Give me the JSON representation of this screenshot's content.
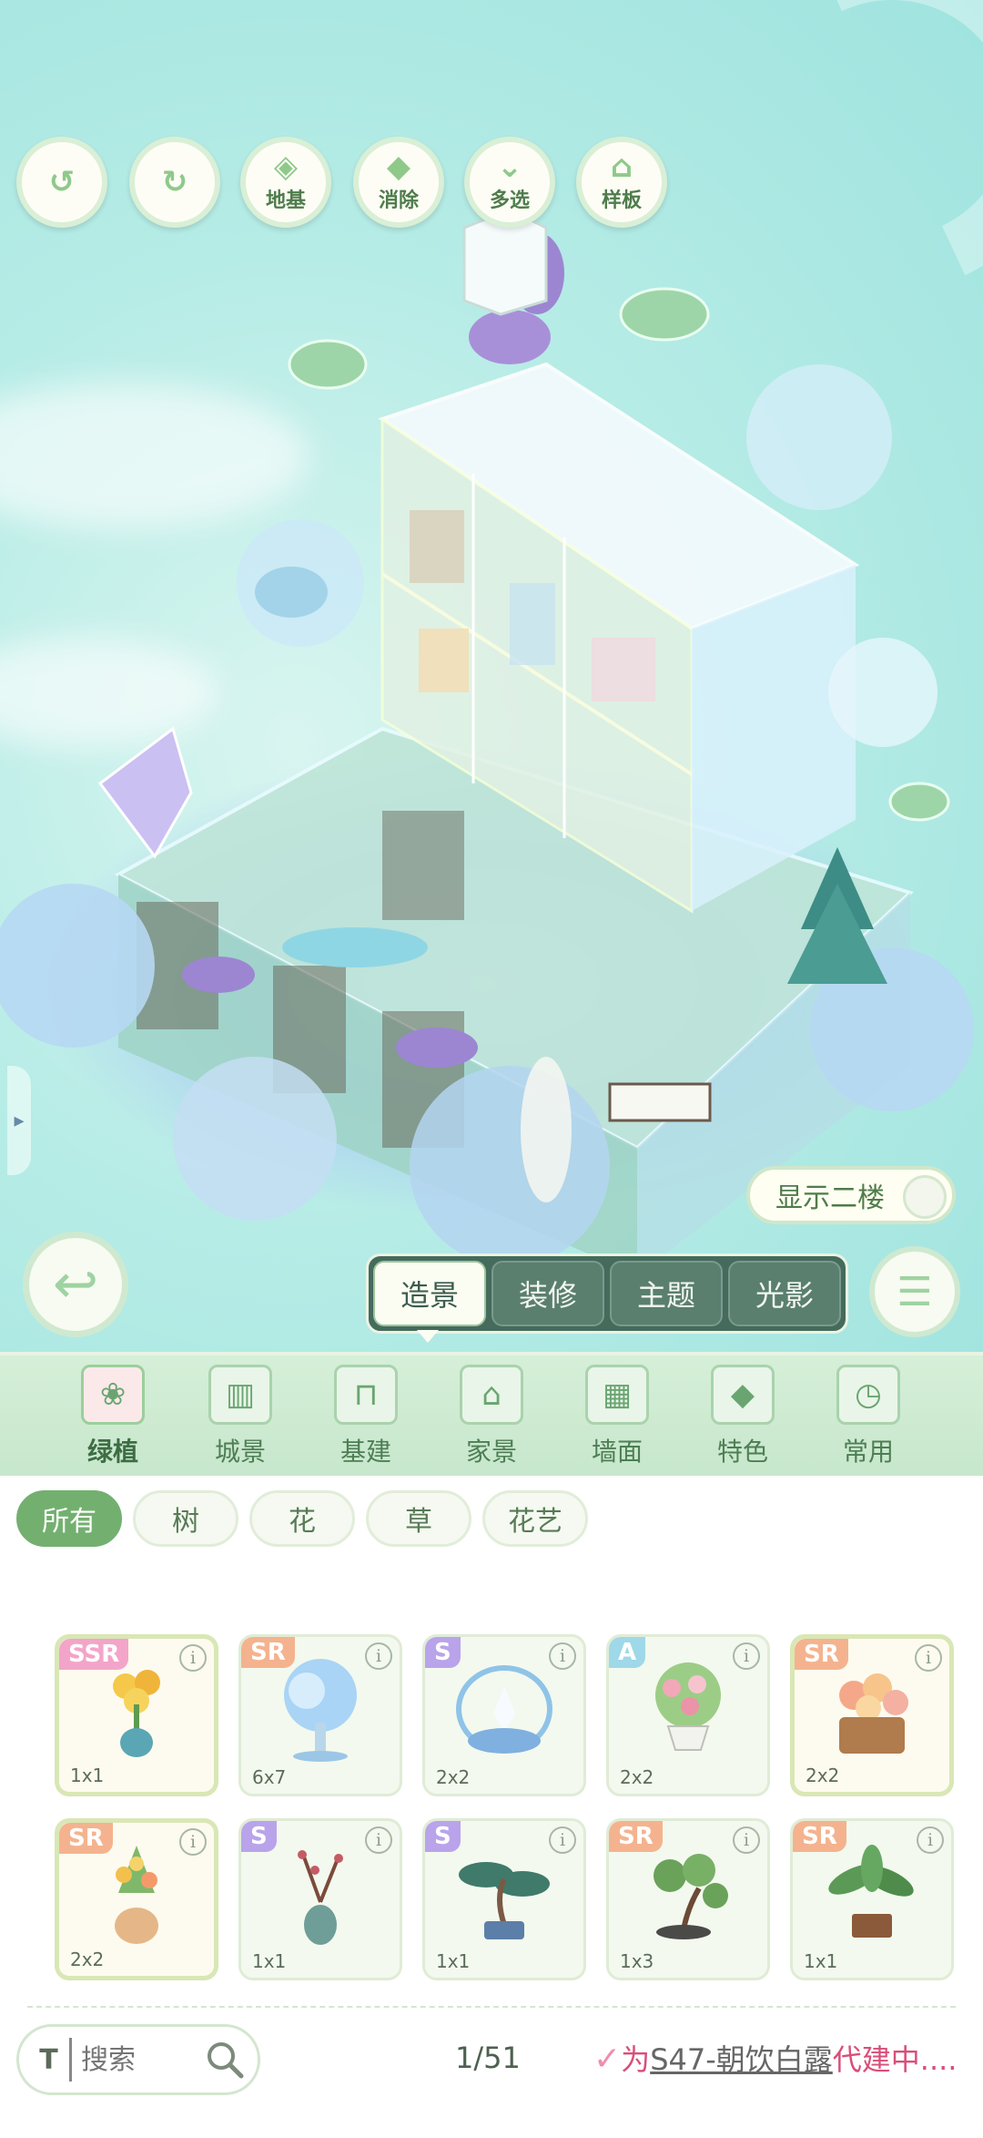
{
  "toolbar": {
    "undo": {
      "icon": "undo-icon"
    },
    "redo": {
      "icon": "redo-icon"
    },
    "foundation": {
      "label": "地基",
      "icon": "foundation-icon"
    },
    "erase": {
      "label": "消除",
      "icon": "eraser-icon"
    },
    "multi_select": {
      "label": "多选",
      "icon": "multi-select-icon"
    },
    "template": {
      "label": "样板",
      "icon": "template-icon"
    }
  },
  "scene": {
    "show_second_floor": {
      "label": "显示二楼",
      "on": false
    }
  },
  "mode_tabs": [
    {
      "label": "造景",
      "active": true
    },
    {
      "label": "装修",
      "active": false
    },
    {
      "label": "主题",
      "active": false
    },
    {
      "label": "光影",
      "active": false
    }
  ],
  "categories": [
    {
      "label": "绿植",
      "icon": "plant-icon",
      "active": true
    },
    {
      "label": "城景",
      "icon": "city-icon",
      "active": false
    },
    {
      "label": "基建",
      "icon": "construction-icon",
      "active": false
    },
    {
      "label": "家景",
      "icon": "home-icon",
      "active": false
    },
    {
      "label": "墙面",
      "icon": "wall-icon",
      "active": false
    },
    {
      "label": "特色",
      "icon": "special-icon",
      "active": false
    },
    {
      "label": "常用",
      "icon": "recent-icon",
      "active": false
    }
  ],
  "filters": [
    {
      "label": "所有",
      "active": true
    },
    {
      "label": "树",
      "active": false
    },
    {
      "label": "花",
      "active": false
    },
    {
      "label": "草",
      "active": false
    },
    {
      "label": "花艺",
      "active": false
    }
  ],
  "items": [
    {
      "rarity": "SSR",
      "size": "1x1",
      "icon": "potted-flower-icon"
    },
    {
      "rarity": "SR",
      "size": "6x7",
      "icon": "blue-tree-icon"
    },
    {
      "rarity": "S",
      "size": "2x2",
      "icon": "lily-bush-icon"
    },
    {
      "rarity": "A",
      "size": "2x2",
      "icon": "flower-urn-icon"
    },
    {
      "rarity": "SR",
      "size": "2x2",
      "icon": "flower-basket-icon"
    },
    {
      "rarity": "SR",
      "size": "2x2",
      "icon": "flower-vase-icon"
    },
    {
      "rarity": "S",
      "size": "1x1",
      "icon": "plum-blossom-vase-icon"
    },
    {
      "rarity": "S",
      "size": "1x1",
      "icon": "bonsai-pine-icon"
    },
    {
      "rarity": "SR",
      "size": "1x3",
      "icon": "bonsai-tree-icon"
    },
    {
      "rarity": "SR",
      "size": "1x1",
      "icon": "fern-pot-icon"
    }
  ],
  "info_glyph": "i",
  "search": {
    "placeholder": "搜索",
    "font_toggle": "T"
  },
  "pager": {
    "text": "1/51"
  },
  "promo": {
    "prefix": "为",
    "name": "S47-朝饮白露",
    "suffix": "代建中...."
  },
  "colors": {
    "accent": "#73b06f",
    "ssr": "#f3a5c9",
    "sr": "#f4b38e",
    "s": "#b9a3ea",
    "a": "#9fd8e8",
    "promo": "#d84f7a"
  }
}
